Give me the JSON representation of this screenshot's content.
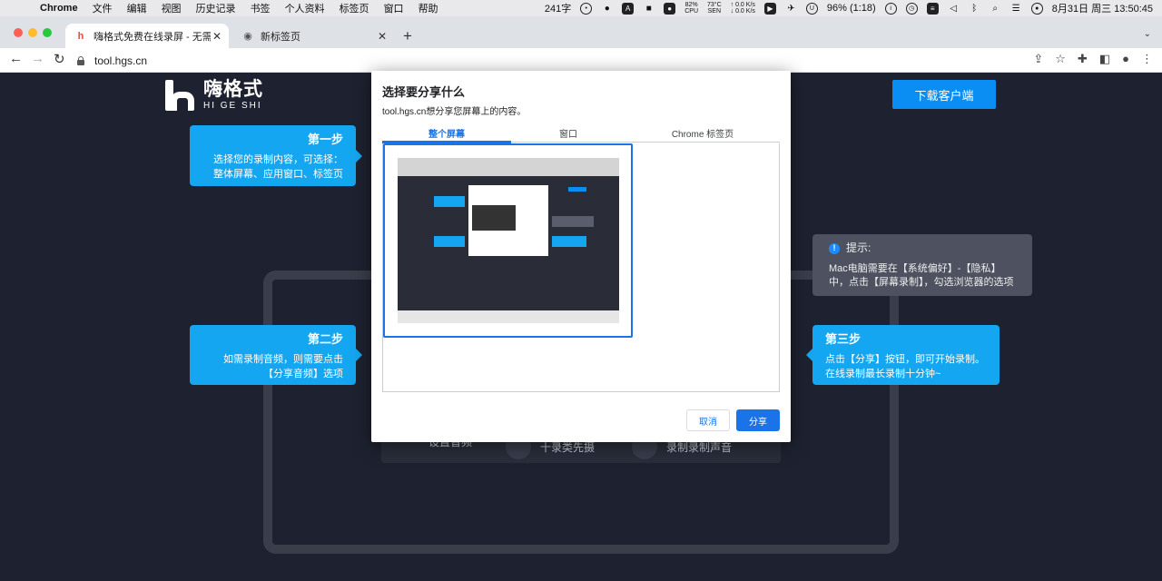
{
  "menubar": {
    "app_name": "Chrome",
    "items": [
      "文件",
      "编辑",
      "视图",
      "历史记录",
      "书签",
      "个人资料",
      "标签页",
      "窗口",
      "帮助"
    ],
    "status": {
      "word_count": "241字",
      "cpu_pct": "82%",
      "cpu_label": "CPU",
      "temp": "73°C",
      "temp_label": "SEN",
      "net_up": "0.0 K/s",
      "net_down": "0.0 K/s",
      "battery": "96% (1:18)",
      "datetime": "8月31日 周三  13:50:45"
    }
  },
  "tabs": [
    {
      "title": "嗨格式免费在线录屏 - 无需下载",
      "favicon": "hgs-logo-icon",
      "close": "✕"
    },
    {
      "title": "新标签页",
      "favicon": "globe-icon",
      "close": "✕"
    }
  ],
  "toolbar": {
    "url": "tool.hgs.cn",
    "back": "←",
    "forward": "→",
    "reload": "↻"
  },
  "page": {
    "logo_cn": "嗨格式",
    "logo_en": "HI GE SHI",
    "download_btn": "下载客户端",
    "step1": {
      "title": "第一步",
      "text1": "选择您的录制内容，可选择：",
      "text2": "整体屏幕、应用窗口、标签页"
    },
    "step2": {
      "title": "第二步",
      "text1": "如需录制音频，则需要点击",
      "text2": "【分享音频】选项"
    },
    "step3": {
      "title": "第三步",
      "text1": "点击【分享】按钮，即可开始录制。",
      "text2": "在线录制最长录制十分钟~"
    },
    "hint": {
      "title": "提示:",
      "text1": "Mac电脑需要在【系统偏好】-【隐私】",
      "text2": "中，点击【屏幕录制】，勾选浏览器的选项"
    },
    "bottom_items": [
      "设置音频",
      "十录类先摄",
      "录制录制声音"
    ]
  },
  "dialog": {
    "title": "选择要分享什么",
    "subtitle": "tool.hgs.cn想分享您屏幕上的内容。",
    "tabs": [
      "整个屏幕",
      "窗口",
      "Chrome 标签页"
    ],
    "cancel": "取消",
    "share": "分享"
  },
  "colors": {
    "accent": "#1a73e8",
    "bubble": "#14a6f0",
    "page_bg": "#1e2230"
  }
}
